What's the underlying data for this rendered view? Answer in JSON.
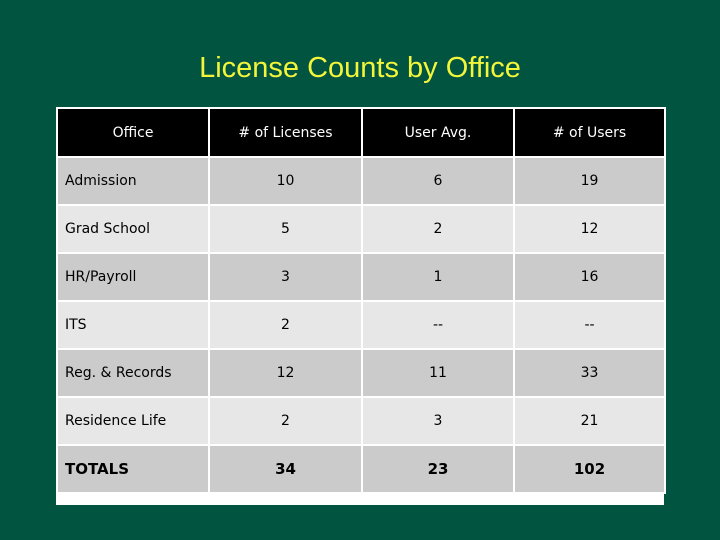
{
  "title": "License Counts by Office",
  "table": {
    "headers": [
      "Office",
      "# of Licenses",
      "User Avg.",
      "# of Users"
    ],
    "rows": [
      {
        "office": "Admission",
        "licenses": "10",
        "user_avg": "6",
        "users": "19"
      },
      {
        "office": "Grad School",
        "licenses": "5",
        "user_avg": "2",
        "users": "12"
      },
      {
        "office": "HR/Payroll",
        "licenses": "3",
        "user_avg": "1",
        "users": "16"
      },
      {
        "office": "ITS",
        "licenses": "2",
        "user_avg": "--",
        "users": "--"
      },
      {
        "office": "Reg. & Records",
        "licenses": "12",
        "user_avg": "11",
        "users": "33"
      },
      {
        "office": "Residence Life",
        "licenses": "2",
        "user_avg": "3",
        "users": "21"
      }
    ],
    "totals": {
      "label": "TOTALS",
      "licenses": "34",
      "user_avg": "23",
      "users": "102"
    }
  },
  "colors": {
    "background": "#005440",
    "title": "#f2f53a",
    "header_bg": "#000000",
    "row_dark": "#cbcbcb",
    "row_light": "#e7e7e7"
  }
}
